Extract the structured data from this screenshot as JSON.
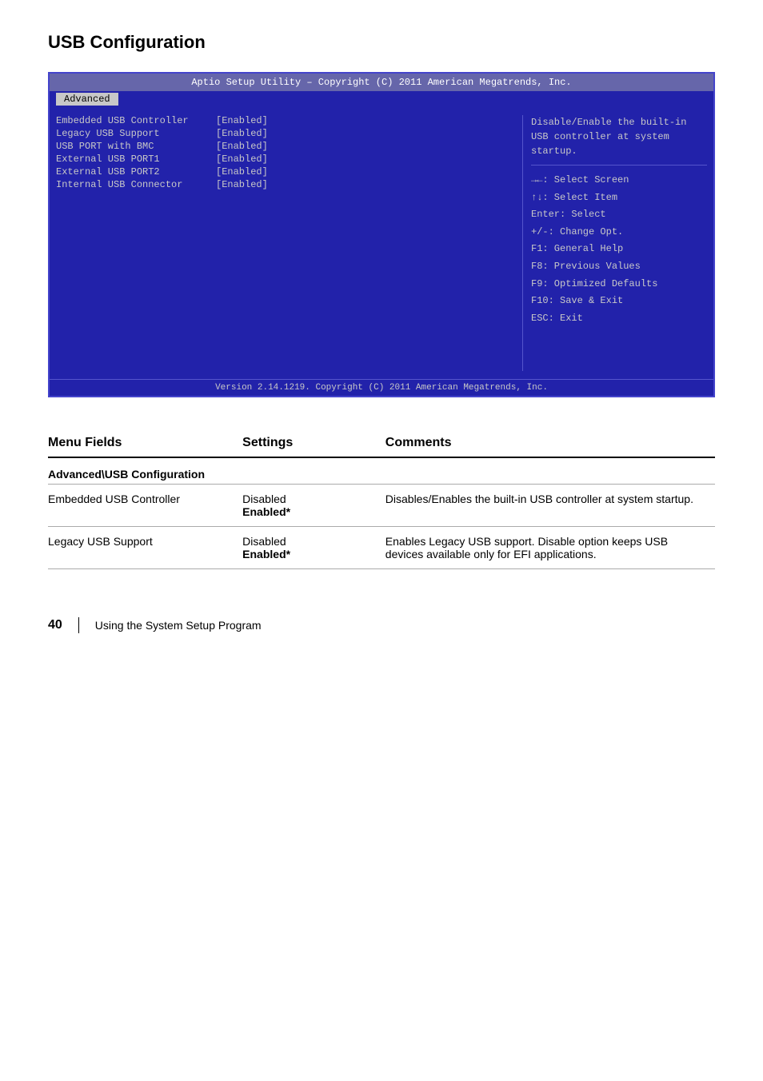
{
  "page": {
    "title": "USB Configuration"
  },
  "bios": {
    "header": "Aptio Setup Utility – Copyright (C) 2011 American Megatrends, Inc.",
    "tab": "Advanced",
    "items": [
      {
        "name": "Embedded USB Controller",
        "value": "[Enabled]"
      },
      {
        "name": "Legacy USB Support",
        "value": "[Enabled]"
      },
      {
        "name": "USB PORT with BMC",
        "value": "[Enabled]"
      },
      {
        "name": "External USB PORT1",
        "value": "[Enabled]"
      },
      {
        "name": "External USB PORT2",
        "value": "[Enabled]"
      },
      {
        "name": "Internal USB Connector",
        "value": "[Enabled]"
      }
    ],
    "help_text": "Disable/Enable the built-in USB controller at system startup.",
    "key_help": [
      "→←: Select Screen",
      "↑↓: Select Item",
      "Enter: Select",
      "+/-: Change Opt.",
      "F1: General Help",
      "F8: Previous Values",
      "F9: Optimized Defaults",
      "F10: Save & Exit",
      "ESC: Exit"
    ],
    "footer": "Version 2.14.1219. Copyright (C) 2011 American Megatrends, Inc."
  },
  "table": {
    "headers": [
      "Menu Fields",
      "Settings",
      "Comments"
    ],
    "section": "Advanced\\USB Configuration",
    "rows": [
      {
        "field": "Embedded USB Controller",
        "settings": [
          "Disabled",
          "Enabled*"
        ],
        "comments": "Disables/Enables the built-in USB controller at system startup."
      },
      {
        "field": "Legacy USB Support",
        "settings": [
          "Disabled",
          "Enabled*"
        ],
        "comments": "Enables Legacy USB support. Disable option keeps USB devices available only for EFI applications."
      }
    ]
  },
  "footer": {
    "page_number": "40",
    "separator": "|",
    "text": "Using the System Setup Program"
  }
}
